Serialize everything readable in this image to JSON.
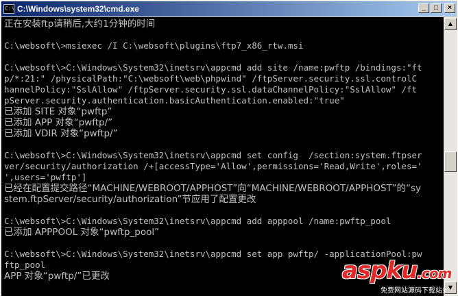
{
  "window": {
    "title": "C:\\Windows\\system32\\cmd.exe",
    "icon": "cmd-icon",
    "buttons": {
      "minimize": "_",
      "maximize": "□",
      "close": "×"
    }
  },
  "console": {
    "lines": [
      "正在安装ftp请稍后,大约1分钟的时间",
      "",
      "C:\\websoft\\>msiexec /I C:\\websoft\\plugins\\ftp7_x86_rtw.msi",
      "",
      "C:\\websoft\\>C:\\Windows\\System32\\inetsrv\\appcmd add site /name:pwftp /bindings:\"ft",
      "p/*:21:\" /physicalPath:\"C:\\websoft\\web\\phpwind\" /ftpServer.security.ssl.controlC",
      "hannelPolicy:\"SslAllow\" /ftpServer.security.ssl.dataChannelPolicy:\"SslAllow\" /ft",
      "pServer.security.authentication.basicAuthentication.enabled:\"true\"",
      "已添加 SITE 对象“pwftp”",
      "已添加 APP 对象“pwftp/”",
      "已添加 VDIR 对象“pwftp/”",
      "",
      "C:\\websoft\\>C:\\Windows\\System32\\inetsrv\\appcmd set config  /section:system.ftpser",
      "ver/security/authorization /+[accessType='Allow',permissions='Read,Write',roles='",
      "',users='pwftp']",
      "已经在配置提交路径“MACHINE/WEBROOT/APPHOST”向“MACHINE/WEBROOT/APPHOST”的“sy",
      "stem.ftpServer/security/authorization”节应用了配置更改",
      "",
      "C:\\websoft\\>C:\\Windows\\System32\\inetsrv\\appcmd add apppool /name:pwftp_pool",
      "已添加 APPPOOL 对象“pwftp_pool”",
      "",
      "C:\\websoft\\>C:\\Windows\\System32\\inetsrv\\appcmd set app pwftp/ -applicationPool:pw",
      "ftp_pool",
      "APP 对象“pwftp/”已更改"
    ]
  },
  "scrollbar": {
    "up": "▲",
    "down": "▼"
  },
  "watermark": {
    "logo_main": "aspku",
    "logo_tld": ".com",
    "tagline": "免费网站源码下载站!"
  }
}
